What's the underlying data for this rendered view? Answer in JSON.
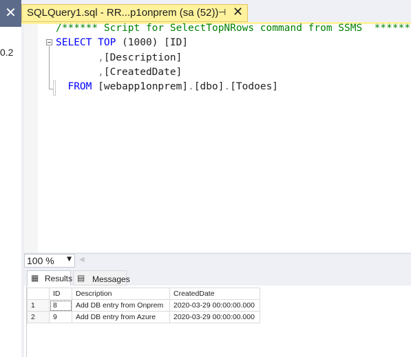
{
  "left_pane": {
    "close_glyph": "✕",
    "node_fragment": "0.2"
  },
  "document_tab": {
    "title": "SQLQuery1.sql - RR...p1onprem (sa (52))",
    "pin_glyph": "⊣",
    "close_glyph": "✕"
  },
  "editor": {
    "line1_comment": "/****** Script for SelectTopNRows command from SSMS  ******/",
    "line2_kw1": "SELECT",
    "line2_kw2": "TOP",
    "line2_rest": " (1000) [ID]",
    "line3_comma": ",",
    "line3_col": "[Description]",
    "line4_comma": ",",
    "line4_col": "[CreatedDate]",
    "line5_kw": "FROM",
    "line5_rest": " [webapp1onprem]",
    "line5_dot1": ".",
    "line5_schema": "[dbo]",
    "line5_dot2": ".",
    "line5_table": "[Todoes]"
  },
  "zoom": {
    "value": "100 %",
    "arrow": "▼",
    "scroll_left": "◀"
  },
  "results_tabs": {
    "results_label": "Results",
    "results_icon": "▦",
    "messages_label": "Messages",
    "messages_icon": "▤"
  },
  "grid": {
    "headers": [
      "",
      "ID",
      "Description",
      "CreatedDate"
    ],
    "rows": [
      {
        "rownum": "1",
        "id": "8",
        "description": "Add DB entry from Onprem",
        "created": "2020-03-29 00:00:00.000"
      },
      {
        "rownum": "2",
        "id": "9",
        "description": "Add DB entry from Azure",
        "created": "2020-03-29 00:00:00.000"
      }
    ]
  }
}
